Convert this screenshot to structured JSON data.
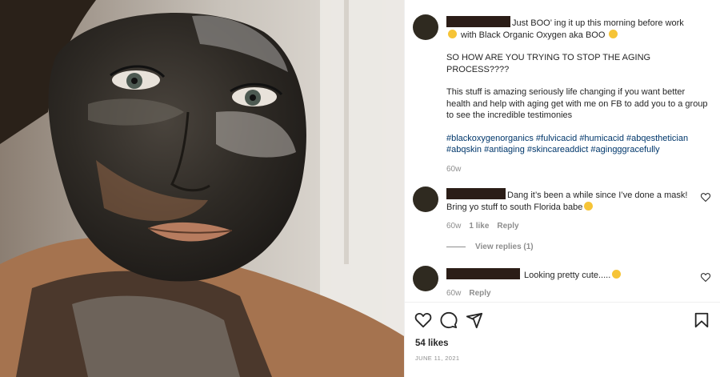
{
  "caption": {
    "line1": "Just BOO’ ing it up this morning before work",
    "line2_after_emoji": " with Black Organic Oxygen aka BOO",
    "question": "SO HOW ARE YOU TRYING TO STOP THE AGING PROCESS????",
    "body": "This stuff is amazing seriously life changing if you want better health and help with aging get with me on FB to add you to a group to see the incredible testimonies",
    "hashtags": "#blackoxygenorganics #fulvicacid #humicacid #abqesthetician #abqskin #antiaging #skincareaddict #agingggracefully",
    "time": "60w"
  },
  "comments": [
    {
      "text_line1": "Dang it’s been a while since I’ve done a mask!",
      "text_line2": "Bring yo stuff to south Florida babe",
      "time": "60w",
      "likes": "1 like",
      "reply": "Reply",
      "view_replies": "View replies (1)"
    },
    {
      "text": " Looking pretty cute.....",
      "time": "60w",
      "reply": "Reply"
    }
  ],
  "post": {
    "likes": "54 likes",
    "date": "JUNE 11, 2021"
  },
  "icons": {
    "like": "heart-icon",
    "comment": "comment-icon",
    "share": "paper-plane-icon",
    "save": "bookmark-icon"
  }
}
